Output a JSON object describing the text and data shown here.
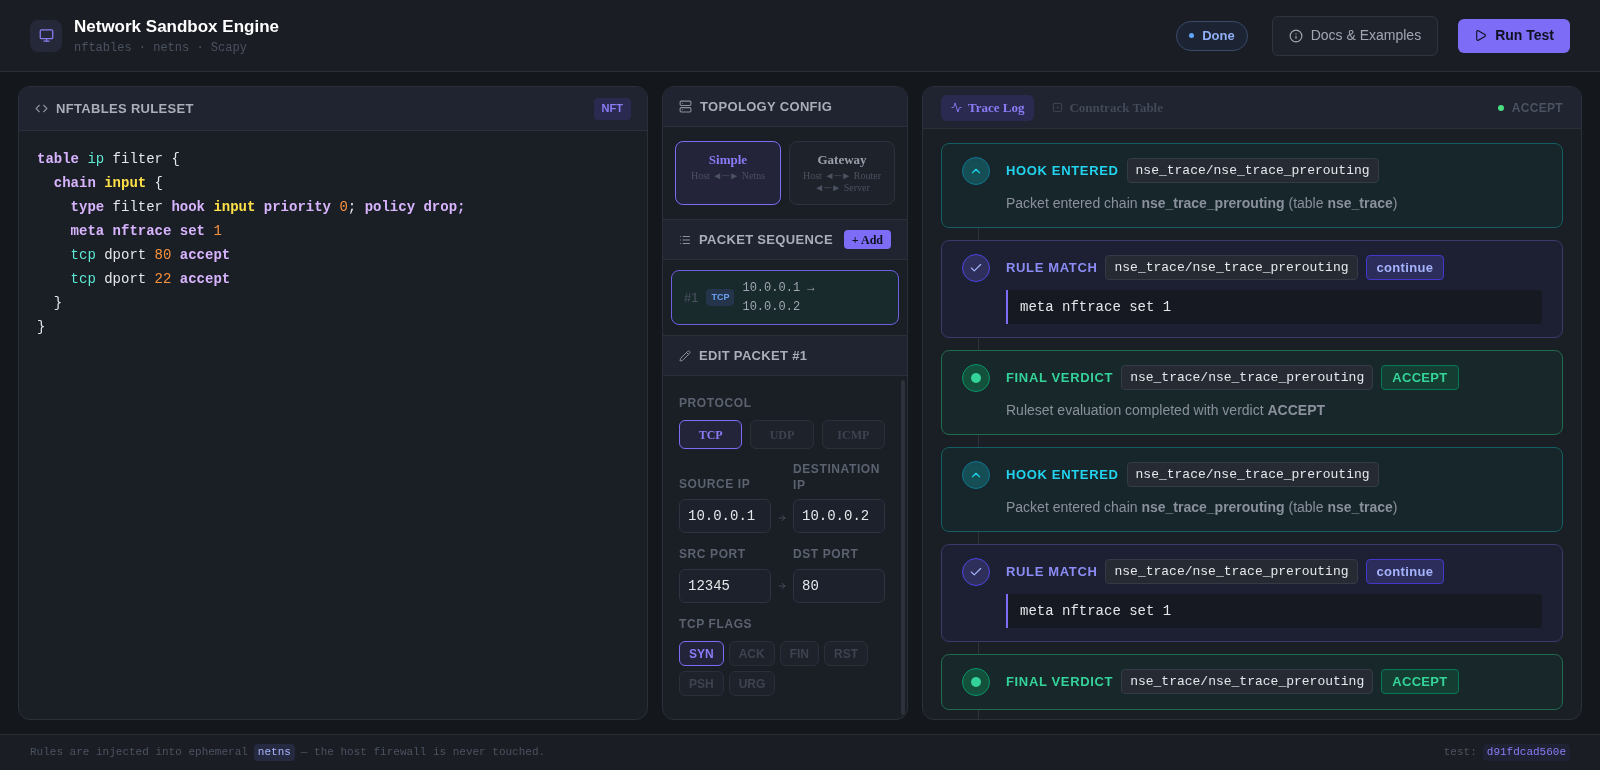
{
  "header": {
    "title": "Network Sandbox Engine",
    "subtitle": "nftables · netns · Scapy",
    "status": {
      "label": "Done",
      "color": "#60a5fa"
    },
    "docs_button": "Docs & Examples",
    "run_button": "Run Test"
  },
  "ruleset": {
    "title": "NFTABLES RULESET",
    "badge": "NFT",
    "code": [
      {
        "tokens": [
          {
            "t": "table",
            "kind": "kw"
          },
          {
            "t": "ip",
            "kind": "type"
          },
          {
            "t": "filter",
            "kind": "plain"
          },
          {
            "t": "{",
            "kind": "plain"
          }
        ],
        "children": [
          {
            "tokens": [
              {
                "t": "chain",
                "kind": "kw"
              },
              {
                "t": "input",
                "kind": "hook"
              },
              {
                "t": "{",
                "kind": "plain"
              }
            ],
            "children": [
              {
                "tokens": [
                  {
                    "t": "type",
                    "kind": "kw"
                  },
                  {
                    "t": "filter",
                    "kind": "plain"
                  },
                  {
                    "t": "hook",
                    "kind": "kw"
                  },
                  {
                    "t": "input",
                    "kind": "hook"
                  },
                  {
                    "t": "priority",
                    "kind": "kw"
                  },
                  {
                    "t": "0",
                    "kind": "num"
                  },
                  {
                    "t": ";",
                    "kind": "punct"
                  },
                  {
                    "t": "policy drop;",
                    "kind": "kw"
                  }
                ]
              },
              {
                "tokens": [
                  {
                    "t": "meta nftrace set",
                    "kind": "kw"
                  },
                  {
                    "t": "1",
                    "kind": "num"
                  }
                ]
              },
              {
                "tokens": [
                  {
                    "t": "tcp",
                    "kind": "type"
                  },
                  {
                    "t": "dport",
                    "kind": "plain"
                  },
                  {
                    "t": "80",
                    "kind": "num"
                  },
                  {
                    "t": "accept",
                    "kind": "kw"
                  }
                ]
              },
              {
                "tokens": [
                  {
                    "t": "tcp",
                    "kind": "type"
                  },
                  {
                    "t": "dport",
                    "kind": "plain"
                  },
                  {
                    "t": "22",
                    "kind": "num"
                  },
                  {
                    "t": "accept",
                    "kind": "kw"
                  }
                ]
              }
            ],
            "close": [
              {
                "t": "}",
                "kind": "plain"
              }
            ]
          }
        ],
        "close": [
          {
            "t": "}",
            "kind": "plain"
          }
        ]
      }
    ]
  },
  "topology": {
    "title": "TOPOLOGY CONFIG",
    "options": [
      {
        "name": "Simple",
        "detail": "Host ◄─► Netns",
        "selected": true
      },
      {
        "name": "Gateway",
        "detail": "Host ◄─► Router ◄─► Server",
        "selected": false
      }
    ]
  },
  "packet_sequence": {
    "title": "PACKET SEQUENCE",
    "add_button": "+ Add",
    "packets": [
      {
        "index": "#1",
        "protocol": "TCP",
        "route": "10.0.0.1 → 10.0.0.2",
        "selected": true
      }
    ]
  },
  "edit_packet": {
    "title": "EDIT PACKET #1",
    "protocol_label": "PROTOCOL",
    "protocols": [
      {
        "label": "TCP",
        "selected": true
      },
      {
        "label": "UDP",
        "selected": false
      },
      {
        "label": "ICMP",
        "selected": false
      }
    ],
    "source_ip_label": "SOURCE IP",
    "source_ip": "10.0.0.1",
    "destination_ip_label": "DESTINATION IP",
    "destination_ip": "10.0.0.2",
    "src_port_label": "SRC PORT",
    "src_port": "12345",
    "dst_port_label": "DST PORT",
    "dst_port": "80",
    "flags_label": "TCP FLAGS",
    "flags": [
      {
        "label": "SYN",
        "on": true
      },
      {
        "label": "ACK",
        "on": false
      },
      {
        "label": "FIN",
        "on": false
      },
      {
        "label": "RST",
        "on": false
      },
      {
        "label": "PSH",
        "on": false
      },
      {
        "label": "URG",
        "on": false
      }
    ]
  },
  "trace": {
    "tabs": [
      {
        "label": "Trace Log",
        "selected": true
      },
      {
        "label": "Conntrack Table",
        "selected": false
      }
    ],
    "verdict": {
      "label": "ACCEPT",
      "color": "#4ade80"
    },
    "events": [
      {
        "kind": "hook",
        "label": "HOOK ENTERED",
        "chain": "nse_trace/nse_trace_prerouting",
        "description": "Packet entered chain **nse_trace_prerouting** (table **nse_trace**)"
      },
      {
        "kind": "rule",
        "label": "RULE MATCH",
        "chain": "nse_trace/nse_trace_prerouting",
        "badge": "continue",
        "code": "meta nftrace set 1"
      },
      {
        "kind": "verdict",
        "label": "FINAL VERDICT",
        "chain": "nse_trace/nse_trace_prerouting",
        "badge": "ACCEPT",
        "description": "Ruleset evaluation completed with verdict **ACCEPT**"
      },
      {
        "kind": "hook",
        "label": "HOOK ENTERED",
        "chain": "nse_trace/nse_trace_prerouting",
        "description": "Packet entered chain **nse_trace_prerouting** (table **nse_trace**)"
      },
      {
        "kind": "rule",
        "label": "RULE MATCH",
        "chain": "nse_trace/nse_trace_prerouting",
        "badge": "continue",
        "code": "meta nftrace set 1"
      },
      {
        "kind": "verdict",
        "label": "FINAL VERDICT",
        "chain": "nse_trace/nse_trace_prerouting",
        "badge": "ACCEPT"
      }
    ]
  },
  "footer": {
    "note_before": "Rules are injected into ephemeral",
    "note_chip": "netns",
    "note_after": "— the host firewall is never touched.",
    "test_label": "test:",
    "test_id": "d91fdcad560e"
  }
}
